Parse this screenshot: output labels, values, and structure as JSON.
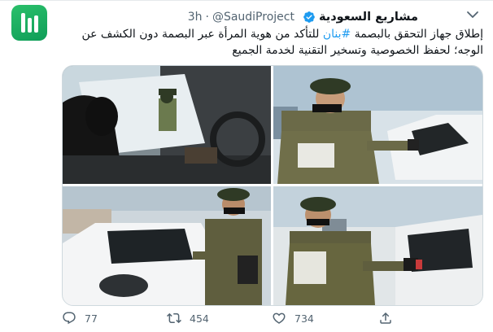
{
  "tweet": {
    "author_name": "مشاريع السعودية",
    "author_handle": "@SaudiProject",
    "separator": "·",
    "time": "3h",
    "text_before": "إطلاق جهاز التحقق بالبصمة ",
    "hashtag": "#بنان",
    "text_after": " للتأكد من هوية المرأة عبر البصمة دون الكشف عن الوجه؛ لحفظ الخصوصية وتسخير التقنية لخدمة الجميع"
  },
  "actions": {
    "reply_count": "77",
    "retweet_count": "454",
    "like_count": "734"
  },
  "icons": {
    "avatar": "saudi-project-logo-icon",
    "verified": "verified-badge-icon",
    "menu": "more-options-chevron-icon",
    "reply": "reply-bubble-icon",
    "retweet": "retweet-arrows-icon",
    "like": "heart-icon",
    "share": "share-icon"
  },
  "colors": {
    "accent": "#1d9bf0",
    "text": "#0f1419",
    "secondary": "#536471",
    "brand_green": "#1aa55a",
    "border": "#cfd9de"
  }
}
